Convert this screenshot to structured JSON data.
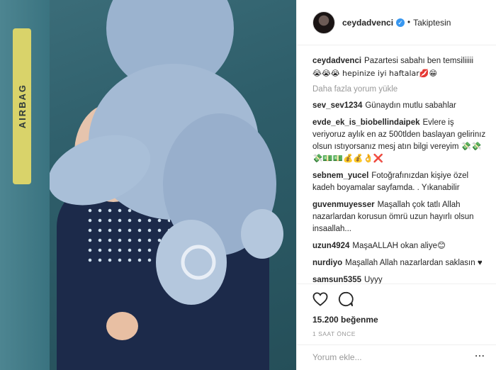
{
  "header": {
    "username": "ceydadvenci",
    "follow_status": "Takiptesin"
  },
  "photo": {
    "airbag_label": "AIRBAG"
  },
  "caption": {
    "user": "ceydadvenci",
    "text": "Pazartesi sabahı ben temsiliiiii",
    "line2": "😭😭😭 hepinize iyi haftalar💋😁"
  },
  "load_more": "Daha fazla yorum yükle",
  "comments": [
    {
      "user": "sev_sev1234",
      "text": "Günaydın mutlu sabahlar"
    },
    {
      "user": "evde_ek_is_biobellindaipek",
      "text": "Evlere iş veriyoruz aylık en az 500tlden baslayan gelirinız olsun ıstıyorsanız mesj atın bilgi vereyim 💸💸💸💵💵💰💰👌❌"
    },
    {
      "user": "sebnem_yucel",
      "text": "Fotoğrafınızdan kişiye özel kadeh boyamalar sayfamda. . Yıkanabilir"
    },
    {
      "user": "guvenmuyesser",
      "text": "Maşallah çok tatlı Allah nazarlardan korusun ömrü uzun hayırlı olsun insaallah..."
    },
    {
      "user": "uzun4924",
      "text": "MaşaALLAH okan aliye😊"
    },
    {
      "user": "nurdiyo",
      "text": "Maşallah Allah nazarlardan saklasın ♥"
    },
    {
      "user": "samsun5355",
      "text": "Uyyy"
    }
  ],
  "likes": "15.200 beğenme",
  "time": "1 SAAT ÖNCE",
  "add_comment": {
    "placeholder": "Yorum ekle...",
    "more": "···"
  },
  "colors": {
    "verified": "#3897f0",
    "muted": "#999999"
  }
}
